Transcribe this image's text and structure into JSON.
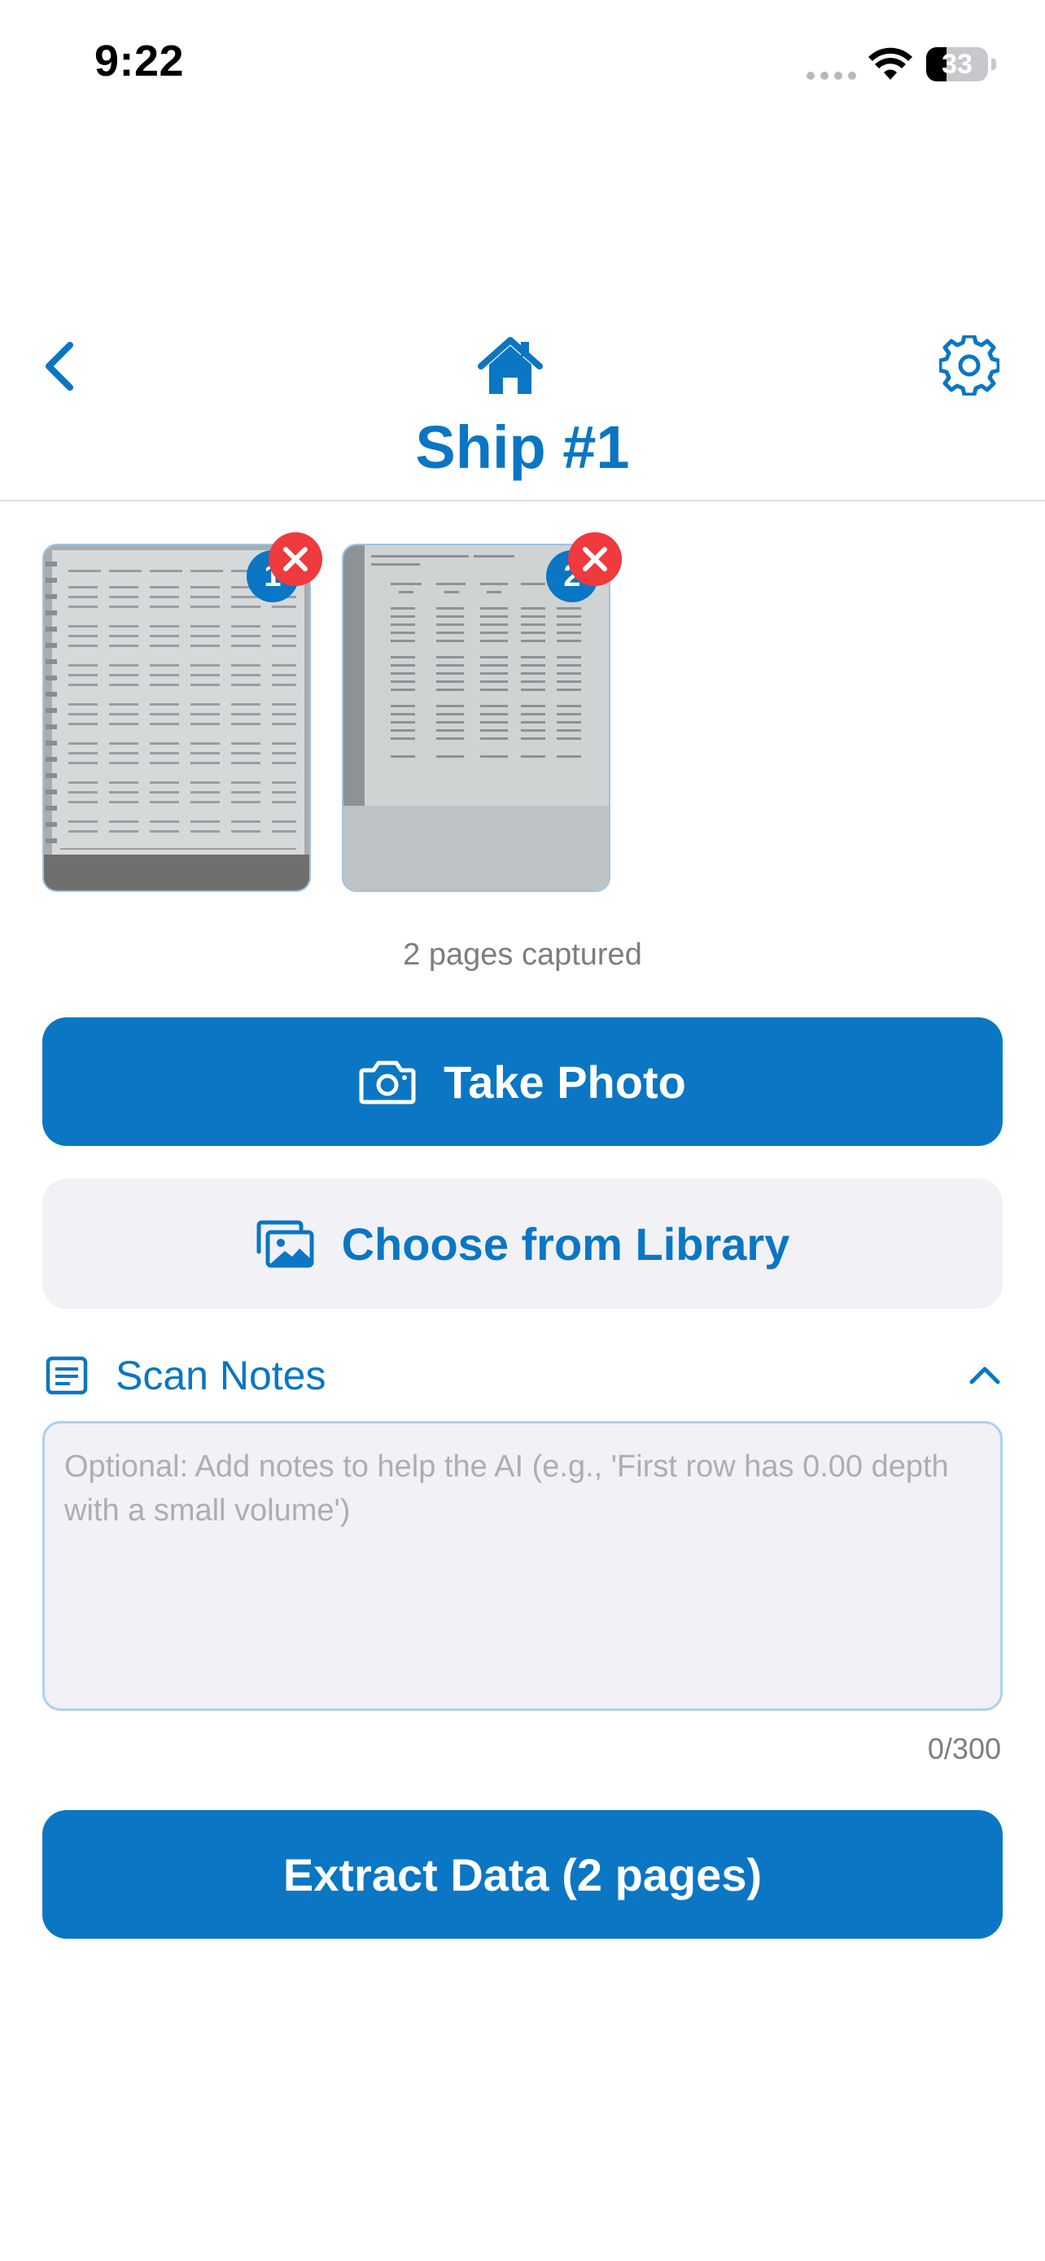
{
  "status_bar": {
    "time": "9:22",
    "battery_level": "33",
    "battery_fraction": 0.33
  },
  "header": {
    "title": "Ship #1",
    "back_icon": "chevron-left-icon",
    "home_icon": "home-icon",
    "settings_icon": "gear-icon"
  },
  "thumbnails": [
    {
      "index": "1",
      "remove_icon": "close-icon"
    },
    {
      "index": "2",
      "remove_icon": "close-icon"
    }
  ],
  "pages_captured": "2 pages captured",
  "actions": {
    "take_photo_label": "Take Photo",
    "take_photo_icon": "camera-icon",
    "library_label": "Choose from Library",
    "library_icon": "photo-library-icon",
    "extract_label": "Extract Data (2 pages)"
  },
  "notes": {
    "label": "Scan Notes",
    "icon": "notes-icon",
    "toggle_icon": "chevron-up-icon",
    "value": "",
    "placeholder": "Optional: Add notes to help the AI (e.g., 'First row has 0.00 depth with a small volume')",
    "char_count": "0/300"
  },
  "colors": {
    "accent": "#0a76c4",
    "remove": "#ef3a3e",
    "secondary_bg": "#f1f1f6",
    "muted_text": "#7d7d82"
  }
}
